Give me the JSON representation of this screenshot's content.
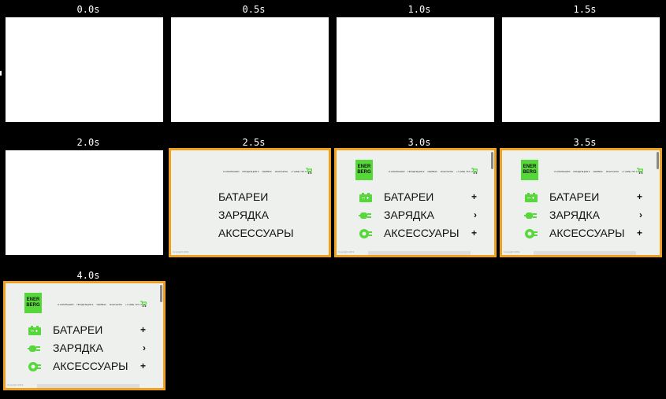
{
  "frames": [
    {
      "time": "0.0s",
      "state": "blank"
    },
    {
      "time": "0.5s",
      "state": "blank"
    },
    {
      "time": "1.0s",
      "state": "blank"
    },
    {
      "time": "1.5s",
      "state": "blank"
    },
    {
      "time": "2.0s",
      "state": "blank"
    },
    {
      "time": "2.5s",
      "state": "partial"
    },
    {
      "time": "3.0s",
      "state": "full"
    },
    {
      "time": "3.5s",
      "state": "full"
    },
    {
      "time": "4.0s",
      "state": "full"
    }
  ],
  "site": {
    "logo_line1": "ENER",
    "logo_line2": "BERG",
    "nav": [
      "О КОМПАНИИ",
      "ПРОДУКЦИЯ ▾",
      "СЕРВИС",
      "КОНТАКТЫ",
      "+7 (999) 797 17 72"
    ],
    "menu": [
      {
        "label": "БАТАРЕИ",
        "action": "+",
        "icon": "battery-icon"
      },
      {
        "label": "ЗАРЯДКА",
        "action": "›",
        "icon": "plug-icon"
      },
      {
        "label": "АКСЕССУАРЫ",
        "action": "+",
        "icon": "accessory-icon"
      }
    ],
    "footer_text": "Copyright 2019"
  },
  "colors": {
    "brand": "#56d83a",
    "border": "#f0a020",
    "background": "#000000"
  }
}
